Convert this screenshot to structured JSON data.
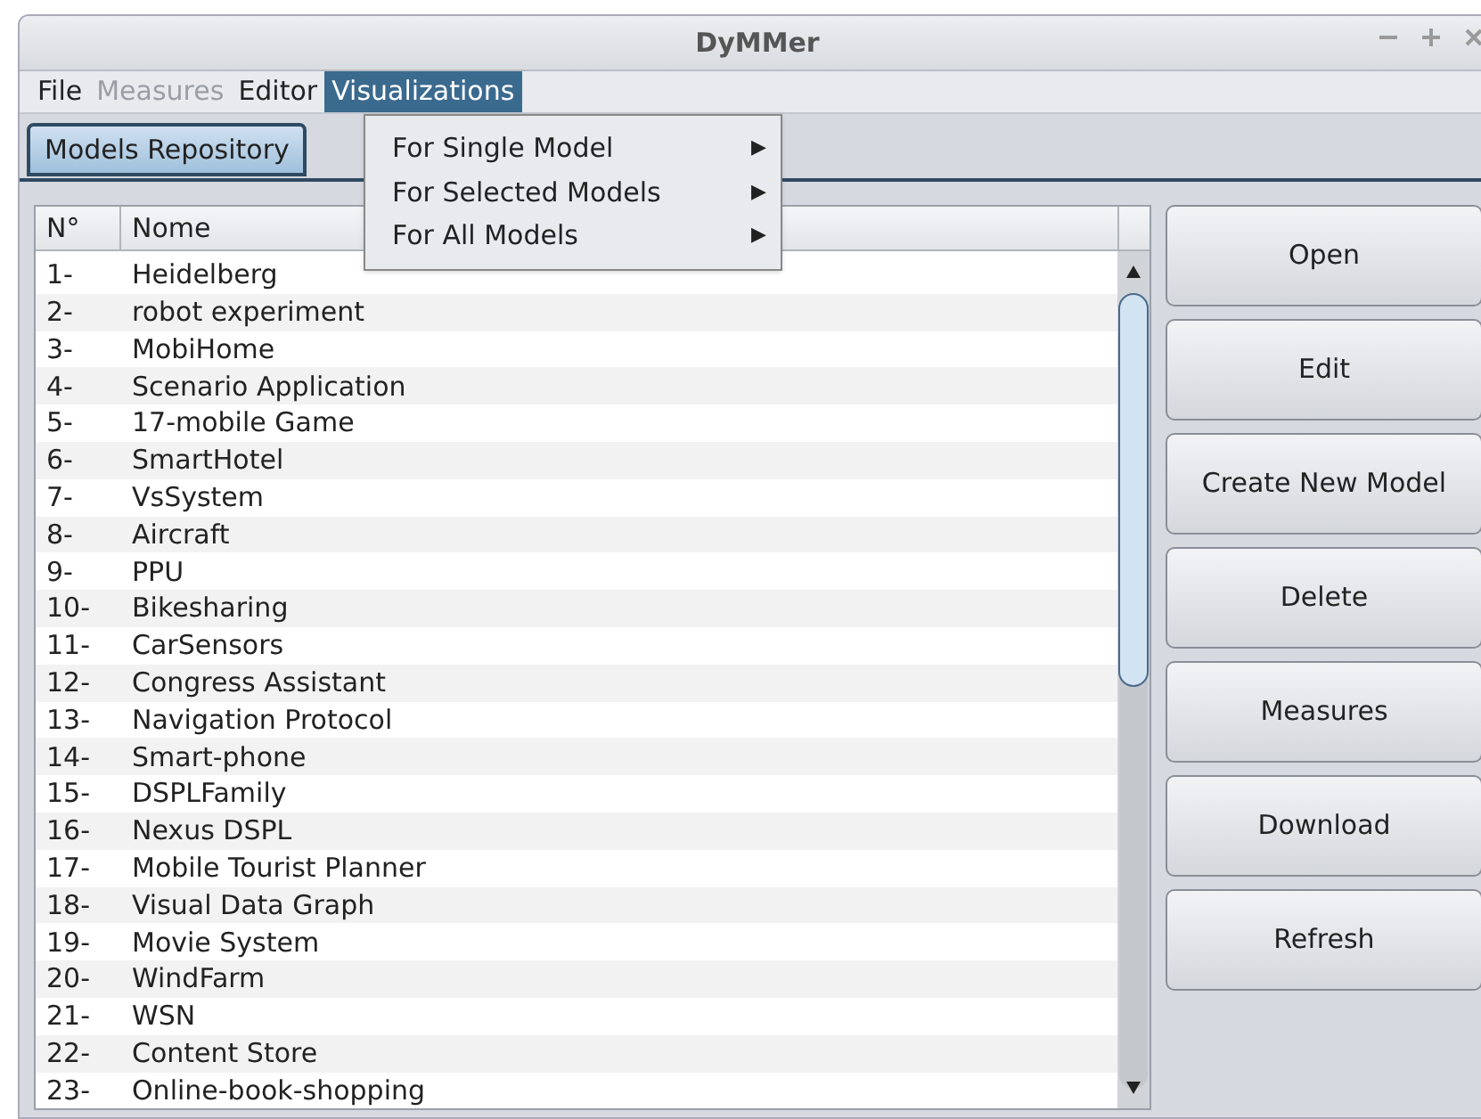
{
  "window": {
    "title": "DyMMer"
  },
  "menu_bar": [
    {
      "label": "File",
      "disabled": false,
      "selected": false
    },
    {
      "label": "Measures",
      "disabled": true,
      "selected": false
    },
    {
      "label": "Editor",
      "disabled": false,
      "selected": false
    },
    {
      "label": "Visualizations",
      "disabled": false,
      "selected": true
    }
  ],
  "open_menu": {
    "items": [
      {
        "label": "For Single Model",
        "submenu_arrow": "▶"
      },
      {
        "label": "For Selected Models",
        "submenu_arrow": "▶"
      },
      {
        "label": "For All Models",
        "submenu_arrow": "▶"
      }
    ]
  },
  "tabs": [
    {
      "label": "Models Repository",
      "selected": true
    }
  ],
  "table": {
    "columns": [
      "N°",
      "Nome"
    ],
    "rows": [
      [
        "1-",
        "Heidelberg"
      ],
      [
        "2-",
        "robot experiment"
      ],
      [
        "3-",
        "MobiHome"
      ],
      [
        "4-",
        "Scenario Application"
      ],
      [
        "5-",
        "17-mobile Game"
      ],
      [
        "6-",
        "SmartHotel"
      ],
      [
        "7-",
        "VsSystem"
      ],
      [
        "8-",
        "Aircraft"
      ],
      [
        "9-",
        "PPU"
      ],
      [
        "10-",
        "Bikesharing"
      ],
      [
        "11-",
        "CarSensors"
      ],
      [
        "12-",
        "Congress Assistant"
      ],
      [
        "13-",
        "Navigation Protocol"
      ],
      [
        "14-",
        "Smart-phone"
      ],
      [
        "15-",
        "DSPLFamily"
      ],
      [
        "16-",
        "Nexus DSPL"
      ],
      [
        "17-",
        "Mobile Tourist Planner"
      ],
      [
        "18-",
        "Visual Data Graph"
      ],
      [
        "19-",
        "Movie System"
      ],
      [
        "20-",
        "WindFarm"
      ],
      [
        "21-",
        "WSN"
      ],
      [
        "22-",
        "Content Store"
      ],
      [
        "23-",
        "Online-book-shopping"
      ]
    ]
  },
  "buttons": [
    "Open",
    "Edit",
    "Create New Model",
    "Delete",
    "Measures",
    "Download",
    "Refresh"
  ]
}
